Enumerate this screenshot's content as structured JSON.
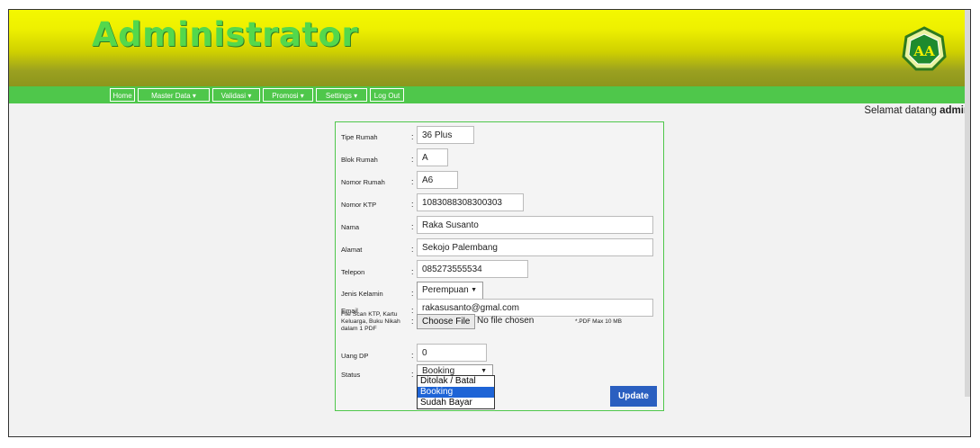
{
  "header": {
    "title": "Administrator",
    "logo_text": "AA"
  },
  "nav": {
    "items": [
      {
        "label": "Home"
      },
      {
        "label": "Master Data",
        "dropdown": true
      },
      {
        "label": "Validasi",
        "dropdown": true
      },
      {
        "label": "Promosi",
        "dropdown": true
      },
      {
        "label": "Settings",
        "dropdown": true
      },
      {
        "label": "Log Out"
      }
    ],
    "caret": "▾"
  },
  "welcome": {
    "prefix": "Selamat datang",
    "user": "admin"
  },
  "form": {
    "colon": ":",
    "tipe_rumah": {
      "label": "Tipe Rumah",
      "value": "36 Plus"
    },
    "blok_rumah": {
      "label": "Blok Rumah",
      "value": "A"
    },
    "nomor_rumah": {
      "label": "Nomor Rumah",
      "value": "A6"
    },
    "nomor_ktp": {
      "label": "Nomor KTP",
      "value": "1083088308300303"
    },
    "nama": {
      "label": "Nama",
      "value": "Raka Susanto"
    },
    "alamat": {
      "label": "Alamat",
      "value": "Sekojo Palembang"
    },
    "telepon": {
      "label": "Telepon",
      "value": "085273555534"
    },
    "jenis_kelamin": {
      "label": "Jenis Kelamin",
      "value": "Perempuan"
    },
    "email": {
      "label": "Email",
      "value": "rakasusanto@gmal.com"
    },
    "file_scan": {
      "label_lines": [
        "File Scan KTP, Kartu",
        "Keluarga, Buku Nikah",
        "dalam 1 PDF"
      ],
      "button": "Choose File",
      "status": "No file chosen",
      "note": "*.PDF Max 10 MB"
    },
    "uang_dp": {
      "label": "Uang DP",
      "value": "0"
    },
    "status": {
      "label": "Status",
      "value": "Booking",
      "options": [
        "Ditolak / Batal",
        "Booking",
        "Sudah Bayar"
      ],
      "highlighted": "Booking"
    },
    "update_button": "Update"
  },
  "colors": {
    "nav_green": "#4fc74b",
    "title_green": "#54d84c",
    "button_blue": "#2a5fc0",
    "highlight_blue": "#1e64d6"
  }
}
